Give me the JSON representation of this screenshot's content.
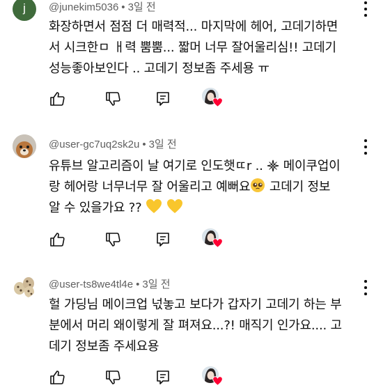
{
  "comments": [
    {
      "avatar_letter": "j",
      "author": "@junekim5036",
      "time": "3일 전",
      "text": "화장하면서 점점 더 매력적... 마지막에 헤어, 고데기하면\n서 시크한ㅁ ㅐ력 뿜뿜... 짧머 너무 잘어울리심!! 고데기\n성능좋아보인다 .. 고데기 정보좀 주세용 ㅠ"
    },
    {
      "author": "@user-gc7uq2sk2u",
      "time": "3일 전",
      "line1_a": "유튜브 알고리즘이 날 여기로 인도햇ㄸr .. ",
      "line1_b": " 메이쿠업이",
      "line2_a": "랑 헤어랑 너무너무 잘 어울리고 예뻐요",
      "line2_b": " 고데기 정보",
      "line3": "알 수 있을가요 ?? "
    },
    {
      "author": "@user-ts8we4tl4e",
      "time": "3일 전",
      "text": "헐 가딩님 메이크업 넋놓고 보다가 갑자기 고데기 하는 부\n분에서 머리 왜이렇게 잘 펴져요...?! 매직기 인가요.... 고\n데기 정보좀 주세요용"
    }
  ],
  "icons": [
    "like-icon",
    "dislike-icon",
    "reply-icon",
    "creator-heart-icon",
    "more-icon"
  ],
  "colors": {
    "meta": "#606060",
    "text": "#0f0f0f",
    "heart": "#ff0033",
    "avatar_j": "#3f6b3b"
  }
}
